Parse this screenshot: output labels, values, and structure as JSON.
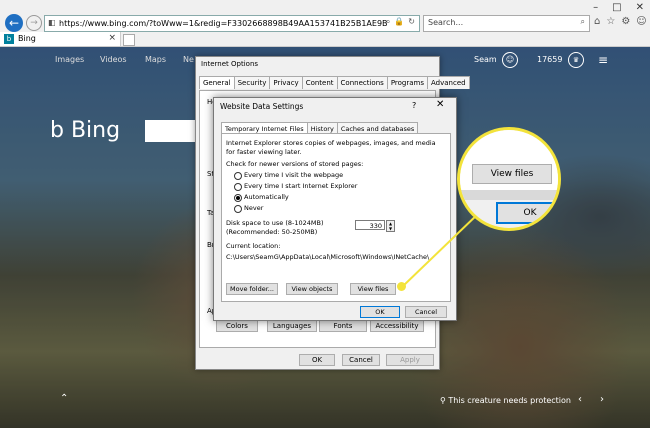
{
  "browser": {
    "url": "https://www.bing.com/?toWww=1&redig=F3302668898B49AA153741B25B1AE9B",
    "search_placeholder": "Search...",
    "tab_label": "Bing"
  },
  "bing": {
    "nav": [
      "Images",
      "Videos",
      "Maps",
      "Ne"
    ],
    "logo_text": "Bing",
    "user_name": "Seam",
    "points": "17659",
    "caption": "This creature needs protection"
  },
  "internet_options": {
    "title": "Internet Options",
    "tabs": [
      "General",
      "Security",
      "Privacy",
      "Content",
      "Connections",
      "Programs",
      "Advanced"
    ],
    "row_labels": [
      "Ho",
      "St",
      "Ta",
      "Br",
      "Ap"
    ],
    "appearance_buttons": [
      "Colors",
      "Languages",
      "Fonts",
      "Accessibility"
    ],
    "ok": "OK",
    "cancel": "Cancel",
    "apply": "Apply"
  },
  "website_data": {
    "title": "Website Data Settings",
    "help": "?",
    "tabs": [
      "Temporary Internet Files",
      "History",
      "Caches and databases"
    ],
    "description_line1": "Internet Explorer stores copies of webpages, images, and media",
    "description_line2": "for faster viewing later.",
    "check_label": "Check for newer versions of stored pages:",
    "options": [
      {
        "label": "Every time I visit the webpage",
        "selected": false
      },
      {
        "label": "Every time I start Internet Explorer",
        "selected": false
      },
      {
        "label": "Automatically",
        "selected": true
      },
      {
        "label": "Never",
        "selected": false
      }
    ],
    "disk_label_line1": "Disk space to use (8-1024MB)",
    "disk_label_line2": "(Recommended: 50-250MB)",
    "disk_value": "330",
    "location_label": "Current location:",
    "location_path": "C:\\Users\\SeamG\\AppData\\Local\\Microsoft\\Windows\\INetCache\\",
    "buttons": {
      "move": "Move folder...",
      "view_objects": "View objects",
      "view_files": "View files"
    },
    "ok": "OK",
    "cancel": "Cancel"
  },
  "callout": {
    "view_files": "View files",
    "ok": "OK",
    "color": "#f3e33b"
  }
}
